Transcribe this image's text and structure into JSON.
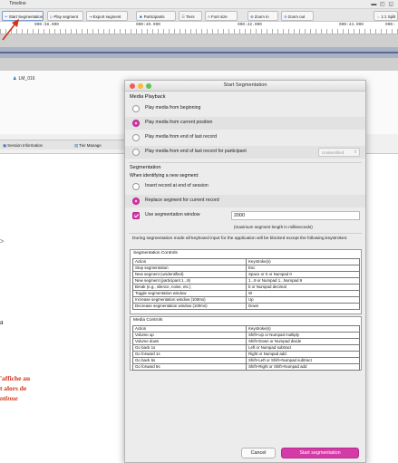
{
  "timeline": {
    "title": "Timeline",
    "toolbar": [
      {
        "icon": "scissors-icon",
        "label": "Start Segmentation"
      },
      {
        "icon": "segment-icon",
        "label": "Play segment"
      },
      {
        "icon": "export-icon",
        "label": "Export segment"
      },
      {
        "icon": "participants-icon",
        "label": "Participants"
      },
      {
        "icon": "tiers-icon",
        "label": "Tiers"
      },
      {
        "icon": "font-icon",
        "label": "Font size"
      },
      {
        "icon": "zoom-in-icon",
        "label": "Zoom in"
      },
      {
        "icon": "zoom-out-icon",
        "label": "Zoom out"
      },
      {
        "icon": "split-icon",
        "label": "1:1 Split"
      }
    ],
    "ruler_labels": [
      "000:38.000",
      "000:40.000",
      "000:42.000",
      "000:44.000",
      "000:"
    ],
    "speaker": "LM_016",
    "tabs": [
      {
        "icon": "session-info-icon",
        "label": "Session Information"
      },
      {
        "icon": "tier-manager-icon",
        "label": "Tier Manage"
      }
    ]
  },
  "background_doc": {
    "gt_fragment": ">",
    "a_fragment": "a",
    "note_lines": [
      "'affiche au",
      "t alors de",
      "ntinue"
    ]
  },
  "dialog": {
    "title": "Start Segmentation",
    "media_playback": {
      "header": "Media Playback",
      "options": [
        {
          "label": "Play media from beginning",
          "selected": false
        },
        {
          "label": "Play media from current position",
          "selected": true
        },
        {
          "label": "Play media from end of last record",
          "selected": false
        },
        {
          "label": "Play media from end of last record for participant",
          "selected": false
        }
      ],
      "participant_select": "Unidentified"
    },
    "segmentation": {
      "header": "Segmentation",
      "when_label": "When identifying a new segment:",
      "options": [
        {
          "label": "Insert record at end of session",
          "selected": false
        },
        {
          "label": "Replace segment for current record",
          "selected": true
        }
      ],
      "window_checkbox_label": "Use segmentation window",
      "window_checked": true,
      "window_value": "2000",
      "window_hint": "(maximum segment length in milliseconds)"
    },
    "info_text": "During segmentation mode all keyboard input for the application will be blocked except the following keystrokes:",
    "segmentation_controls": {
      "caption": "Segmentation Controls",
      "headers": [
        "Action",
        "Keystroke(s)"
      ],
      "rows": [
        [
          "Stop segmentation",
          "Esc"
        ],
        [
          "New segment (unidentified)",
          "Space or 0 or Numpad 0"
        ],
        [
          "New segment (participant 1...9)",
          "1...9 or Numpad 1...Numpad 9"
        ],
        [
          "Break (e.g., silence, noise, etc.)",
          "b or Numpad decimal"
        ],
        [
          "Toggle segmentation window",
          "W"
        ],
        [
          "Increase segmentation window (100ms)",
          "Up"
        ],
        [
          "Decrease segmentation window (100ms)",
          "Down"
        ]
      ]
    },
    "media_controls": {
      "caption": "Media Controls",
      "headers": [
        "Action",
        "Keystroke(s)"
      ],
      "rows": [
        [
          "Volume up",
          "Shift+Up or Numpad multiply"
        ],
        [
          "Volume down",
          "Shift+Down or Numpad divide"
        ],
        [
          "Go back 1s",
          "Left or Numpad subtract"
        ],
        [
          "Go forward 1s",
          "Right or Numpad add"
        ],
        [
          "Go back 5s",
          "Shift+Left or Shift+Numpad subtract"
        ],
        [
          "Go forward 5s",
          "Shift+Right or Shift+Numpad add"
        ]
      ]
    },
    "buttons": {
      "cancel": "Cancel",
      "start": "Start segmentation"
    }
  },
  "colors": {
    "accent": "#d53ba7",
    "annotation_red": "#d23318",
    "link_blue": "#3a6fb0"
  }
}
